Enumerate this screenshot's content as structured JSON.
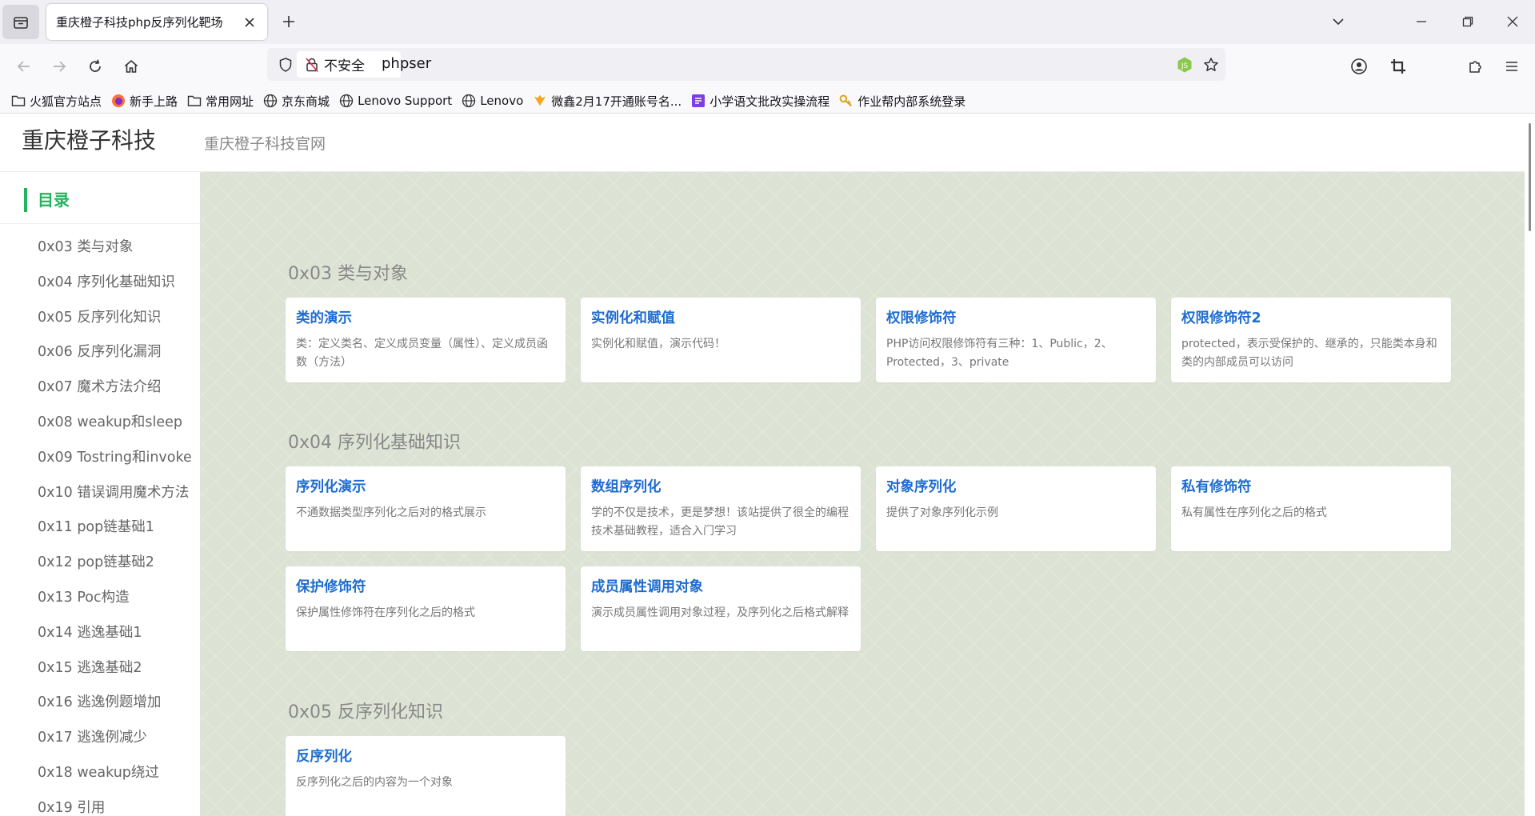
{
  "browser": {
    "tab": {
      "title": "重庆橙子科技php反序列化靶场"
    },
    "url": {
      "security_label": "不安全",
      "text": "phpser"
    },
    "bookmarks": [
      {
        "label": "火狐官方站点",
        "icon": "folder-icon"
      },
      {
        "label": "新手上路",
        "icon": "firefox-icon"
      },
      {
        "label": "常用网址",
        "icon": "folder-icon"
      },
      {
        "label": "京东商城",
        "icon": "globe-icon"
      },
      {
        "label": "Lenovo Support",
        "icon": "globe-icon"
      },
      {
        "label": "Lenovo",
        "icon": "globe-icon"
      },
      {
        "label": "微鑫2月17开通账号名...",
        "icon": "orange-app-icon"
      },
      {
        "label": "小学语文批改实操流程",
        "icon": "purple-doc-icon"
      },
      {
        "label": "作业帮内部系统登录",
        "icon": "key-icon"
      }
    ]
  },
  "site": {
    "title": "重庆橙子科技",
    "subtitle": "重庆橙子科技官网"
  },
  "toc": {
    "title": "目录",
    "items": [
      "0x03 类与对象",
      "0x04 序列化基础知识",
      "0x05 反序列化知识",
      "0x06 反序列化漏洞",
      "0x07 魔术方法介绍",
      "0x08 weakup和sleep",
      "0x09 Tostring和invoke",
      "0x10 错误调用魔术方法",
      "0x11 pop链基础1",
      "0x12 pop链基础2",
      "0x13 Poc构造",
      "0x14 逃逸基础1",
      "0x15 逃逸基础2",
      "0x16 逃逸例题增加",
      "0x17 逃逸例减少",
      "0x18 weakup绕过",
      "0x19 引用"
    ]
  },
  "sections": [
    {
      "title": "0x03 类与对象",
      "cards": [
        {
          "title": "类的演示",
          "desc": "类：定义类名、定义成员变量（属性）、定义成员函数（方法）"
        },
        {
          "title": "实例化和赋值",
          "desc": "实例化和赋值，演示代码！"
        },
        {
          "title": "权限修饰符",
          "desc": "PHP访问权限修饰符有三种：1、Public，2、Protected，3、private"
        },
        {
          "title": "权限修饰符2",
          "desc": "protected，表示受保护的、继承的，只能类本身和类的内部成员可以访问"
        }
      ]
    },
    {
      "title": "0x04 序列化基础知识",
      "cards": [
        {
          "title": "序列化演示",
          "desc": "不通数据类型序列化之后对的格式展示"
        },
        {
          "title": "数组序列化",
          "desc": "学的不仅是技术，更是梦想！该站提供了很全的编程技术基础教程，适合入门学习"
        },
        {
          "title": "对象序列化",
          "desc": "提供了对象序列化示例"
        },
        {
          "title": "私有修饰符",
          "desc": "私有属性在序列化之后的格式"
        },
        {
          "title": "保护修饰符",
          "desc": "保护属性修饰符在序列化之后的格式"
        },
        {
          "title": "成员属性调用对象",
          "desc": "演示成员属性调用对象过程，及序列化之后格式解释"
        }
      ]
    },
    {
      "title": "0x05 反序列化知识",
      "cards": [
        {
          "title": "反序列化",
          "desc": "反序列化之后的内容为一个对象"
        }
      ]
    }
  ]
}
